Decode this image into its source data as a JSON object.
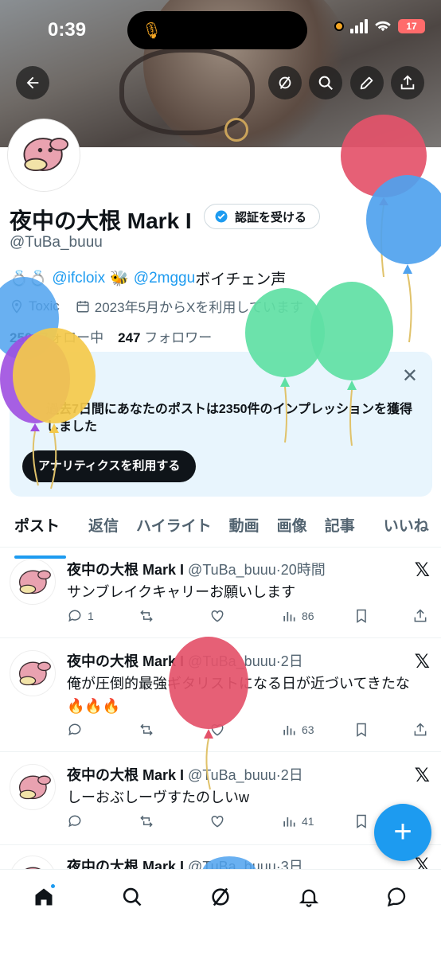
{
  "status_bar": {
    "time": "0:39",
    "battery": "17"
  },
  "profile": {
    "name": "夜中の大根 Mark I",
    "verify_label": "認証を受ける",
    "handle": "@TuBa_buuu",
    "bio_emoji": "💍💍",
    "bio_link1": "@ifcloix",
    "bio_emoji2": "🐝",
    "bio_link2": "@2mggu",
    "bio_text": "ボイチェン声",
    "location": "Toxic",
    "joined": "2023年5月からXを利用しています",
    "following_count": "250",
    "following_label": "フォロー中",
    "followers_count": "247",
    "followers_label": "フォロワー"
  },
  "analytics_card": {
    "text": "過去7日間にあなたのポストは2350件のインプレッションを獲得しました",
    "button": "アナリティクスを利用する"
  },
  "tabs": [
    "ポスト",
    "返信",
    "ハイライト",
    "動画",
    "画像",
    "記事",
    "いいね"
  ],
  "posts": [
    {
      "name": "夜中の大根 Mark I",
      "handle": "@TuBa_buuu",
      "time": "20時間",
      "text": "サンブレイクキャリーお願いします",
      "replies": "1",
      "views": "86"
    },
    {
      "name": "夜中の大根 Mark I",
      "handle": "@TuBa_buuu",
      "time": "2日",
      "text": "俺が圧倒的最強ギタリストになる日が近づいてきたな🔥🔥🔥",
      "replies": "",
      "views": "63"
    },
    {
      "name": "夜中の大根 Mark I",
      "handle": "@TuBa_buuu",
      "time": "2日",
      "text": "しーおぶしーヴすたのしいw",
      "replies": "",
      "views": "41"
    },
    {
      "name": "夜中の大根 Mark I",
      "handle": "@TuBa_buuu",
      "time": "3日",
      "text": "",
      "replies": "",
      "views": ""
    }
  ],
  "fab_label": "+",
  "icons": {
    "back": "back-arrow-icon",
    "grok": "grok-icon",
    "search": "search-icon",
    "edit": "pencil-icon",
    "share": "share-icon",
    "home": "home-icon",
    "explore": "search-icon",
    "notifications": "bell-icon",
    "messages": "chat-icon"
  },
  "colors": {
    "accent": "#1d9bf0",
    "text": "#0f1419",
    "muted": "#536471",
    "card_bg": "#e8f5fd"
  }
}
